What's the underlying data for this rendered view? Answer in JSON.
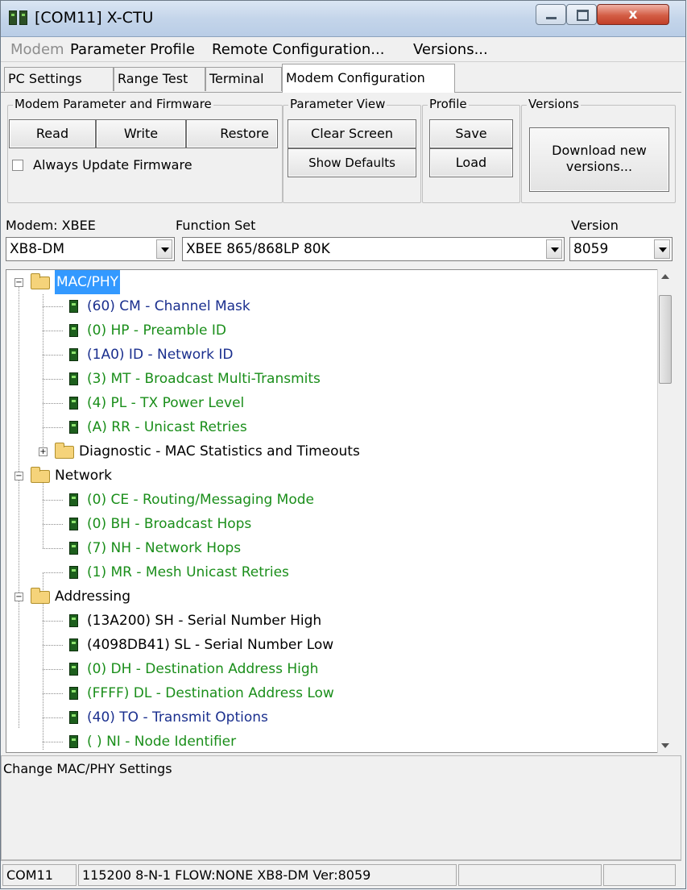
{
  "window": {
    "title": "[COM11] X-CTU",
    "close_label": "x"
  },
  "menu": {
    "items": [
      {
        "label": "Modem",
        "disabled": true
      },
      {
        "label": "Parameter"
      },
      {
        "label": "Profile"
      },
      {
        "label": "Remote Configuration..."
      },
      {
        "label": "Versions..."
      }
    ]
  },
  "tabs": [
    "PC Settings",
    "Range Test",
    "Terminal",
    "Modem Configuration"
  ],
  "groups": {
    "modem_param": {
      "label": "Modem Parameter and Firmware",
      "read": "Read",
      "write": "Write",
      "restore": "Restore",
      "always_update": "Always Update Firmware"
    },
    "param_view": {
      "label": "Parameter View",
      "clear": "Clear Screen",
      "show_defaults": "Show Defaults"
    },
    "profile": {
      "label": "Profile",
      "save": "Save",
      "load": "Load"
    },
    "versions": {
      "label": "Versions",
      "download": "Download new versions..."
    }
  },
  "selectors": {
    "modem_label": "Modem: XBEE",
    "modem_value": "XB8-DM",
    "function_label": "Function Set",
    "function_value": "XBEE 865/868LP 80K",
    "version_label": "Version",
    "version_value": "8059"
  },
  "tree": {
    "macphy": {
      "label": "MAC/PHY",
      "items": [
        "(60) CM - Channel Mask",
        "(0) HP - Preamble ID",
        "(1A0) ID - Network ID",
        "(3) MT - Broadcast Multi-Transmits",
        "(4) PL - TX Power Level",
        "(A) RR - Unicast Retries"
      ],
      "diagnostic": "Diagnostic - MAC Statistics and Timeouts"
    },
    "network": {
      "label": "Network",
      "items": [
        "(0) CE - Routing/Messaging Mode",
        "(0) BH - Broadcast Hops",
        "(7) NH - Network Hops",
        "(1) MR - Mesh Unicast Retries"
      ]
    },
    "addressing": {
      "label": "Addressing",
      "items": [
        "(13A200) SH - Serial Number High",
        "(4098DB41) SL - Serial Number Low",
        "(0) DH - Destination Address High",
        "(FFFF) DL - Destination Address Low",
        "(40) TO - Transmit Options",
        "( ) NI - Node Identifier"
      ]
    }
  },
  "description": "Change MAC/PHY Settings",
  "status": {
    "port": "COM11",
    "settings": "115200 8-N-1  FLOW:NONE   XB8-DM  Ver:8059"
  },
  "colors": {
    "modified_param": "#1a8e1a",
    "readonly_param": "#1a2f8e",
    "selection": "#3399ff"
  }
}
